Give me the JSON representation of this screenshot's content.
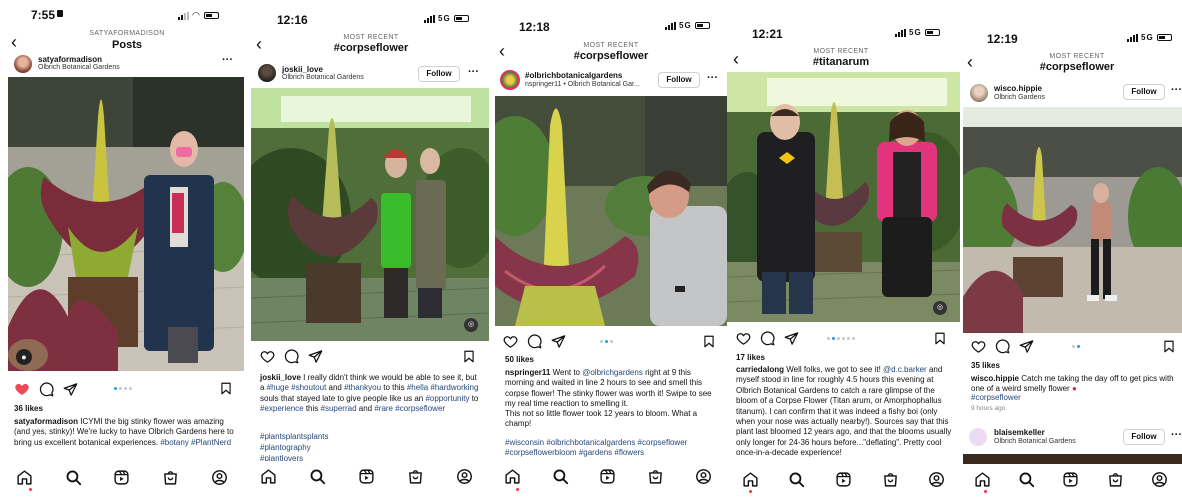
{
  "colors": {
    "heart": "#ed4956",
    "link": "#26487a",
    "follow_border": "#cfcfcf"
  },
  "screens": [
    {
      "status_time": "7:55",
      "header_sub": "SATYAFORMADISON",
      "header_title": "Posts",
      "user": "satyaformadison",
      "location": "Olbrich Botanical Gardens",
      "likes": "36 likes",
      "caption_user": "satyaformadison",
      "caption_text": " ICYMI the big stinky flower was amazing (and yes, stinky)! We're lucky to have Olbrich Gardens here to bring us excellent botanical experiences. ",
      "caption_tags": "#botany #PlantNerd"
    },
    {
      "status_time": "12:16",
      "network": "5G",
      "header_sub": "MOST RECENT",
      "header_title": "#corpseflower",
      "user": "joskii_love",
      "location": "Olbrich Botanical Gardens",
      "follow": "Follow",
      "caption_user": "joskii_love",
      "caption_parts": [
        " I really didn't think we would be able to see it, but a ",
        "#huge",
        " ",
        "#shoutout",
        " and ",
        "#thankyou",
        " to this ",
        "#hella",
        " ",
        "#hardworking",
        " souls that stayed late to give people like us an ",
        "#opportunity",
        " to ",
        "#experience",
        " this ",
        "#superrad",
        " and ",
        "#rare",
        " ",
        "#corpseflower"
      ],
      "extra_tags": [
        "#plantsplantsplants",
        "#plantography",
        "#plantlovers"
      ]
    },
    {
      "status_time": "12:18",
      "network": "5G",
      "header_sub": "MOST RECENT",
      "header_title": "#corpseflower",
      "user": "#olbrichbotanicalgardens",
      "location": "nspringer11 • Olbrich Botanical Gar...",
      "follow": "Follow",
      "likes": "50 likes",
      "caption_user": "nspringer11",
      "caption_pre": " Went to ",
      "caption_mention": "@olbrichgardens",
      "caption_text": " right at 9 this morning and waited in line 2 hours to see and smell this corpse flower! The stinky flower was worth it! Swipe to see my real time reaction to smelling it.",
      "caption_text2": "This not so little flower took 12 years to bloom. What a champ!",
      "caption_tags": "#wisconsin #olbrichbotanicalgardens #corpseflower #corpseflowerbloom #gardens #flowers"
    },
    {
      "status_time": "12:21",
      "network": "5G",
      "header_sub": "MOST RECENT",
      "header_title": "#titanarum",
      "likes": "17 likes",
      "caption_user": "carriedalong",
      "caption_pre": " Well folks, we got to see it! ",
      "caption_mention": "@d.c.barker",
      "caption_text": " and myself stood in line for roughly 4.5 hours this evening at Olbrich Botanical Gardens to catch a rare glimpse of the bloom of a Corpse Flower (Titan arum, or Amorphophallus titanum). I can confirm that it was indeed a fishy boi (only when your nose was actually nearby!). Sources say that this plant last bloomed 12 years ago, and that the blooms usually only longer for 24-36 hours before...\"deflating\". Pretty cool once-in-a-decade experience!"
    },
    {
      "status_time": "12:19",
      "network": "5G",
      "header_sub": "MOST RECENT",
      "header_title": "#corpseflower",
      "user": "wisco.hippie",
      "location": "Olbrich Gardens",
      "follow": "Follow",
      "likes": "35 likes",
      "caption_user": "wisco.hippie",
      "caption_text": " Catch me taking the day off to get pics with one of a weird smelly flower ",
      "caption_tags": "#corpseflower",
      "time_ago": "9 hours ago",
      "next_user": "blaisemkeller",
      "next_location": "Olbrich Botanical Gardens",
      "next_follow": "Follow"
    }
  ]
}
